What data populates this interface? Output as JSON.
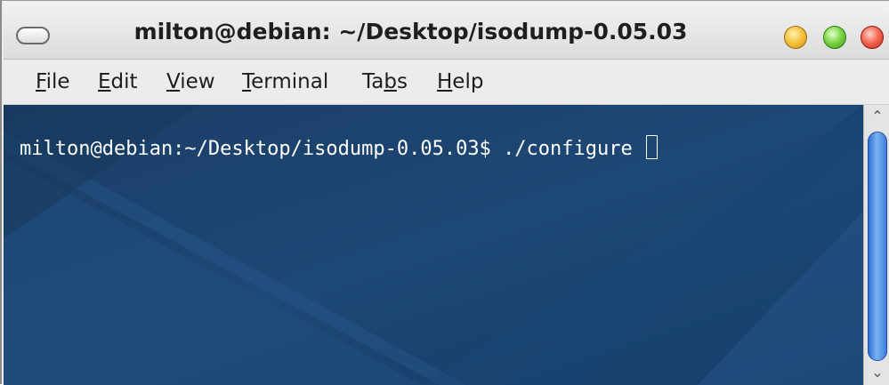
{
  "window": {
    "title": "milton@debian: ~/Desktop/isodump-0.05.03"
  },
  "menu": {
    "items": [
      {
        "pre": "",
        "mnemonic": "F",
        "post": "ile"
      },
      {
        "pre": "",
        "mnemonic": "E",
        "post": "dit"
      },
      {
        "pre": "",
        "mnemonic": "V",
        "post": "iew"
      },
      {
        "pre": "",
        "mnemonic": "T",
        "post": "erminal"
      },
      {
        "pre": "Ta",
        "mnemonic": "b",
        "post": "s"
      },
      {
        "pre": "",
        "mnemonic": "H",
        "post": "elp"
      }
    ]
  },
  "terminal": {
    "prompt": "milton@debian:~/Desktop/isodump-0.05.03$ ",
    "command": "./configure "
  },
  "colors": {
    "terminal_bg": "#1c4470",
    "terminal_text": "#ffffff",
    "scroll_thumb": "#4a8ae0"
  },
  "icons": {
    "shade": "shade-icon",
    "minimize": "minimize-icon",
    "maximize": "maximize-icon",
    "close": "close-icon",
    "scroll_up": "chevron-up-icon",
    "scroll_down": "chevron-down-icon"
  }
}
